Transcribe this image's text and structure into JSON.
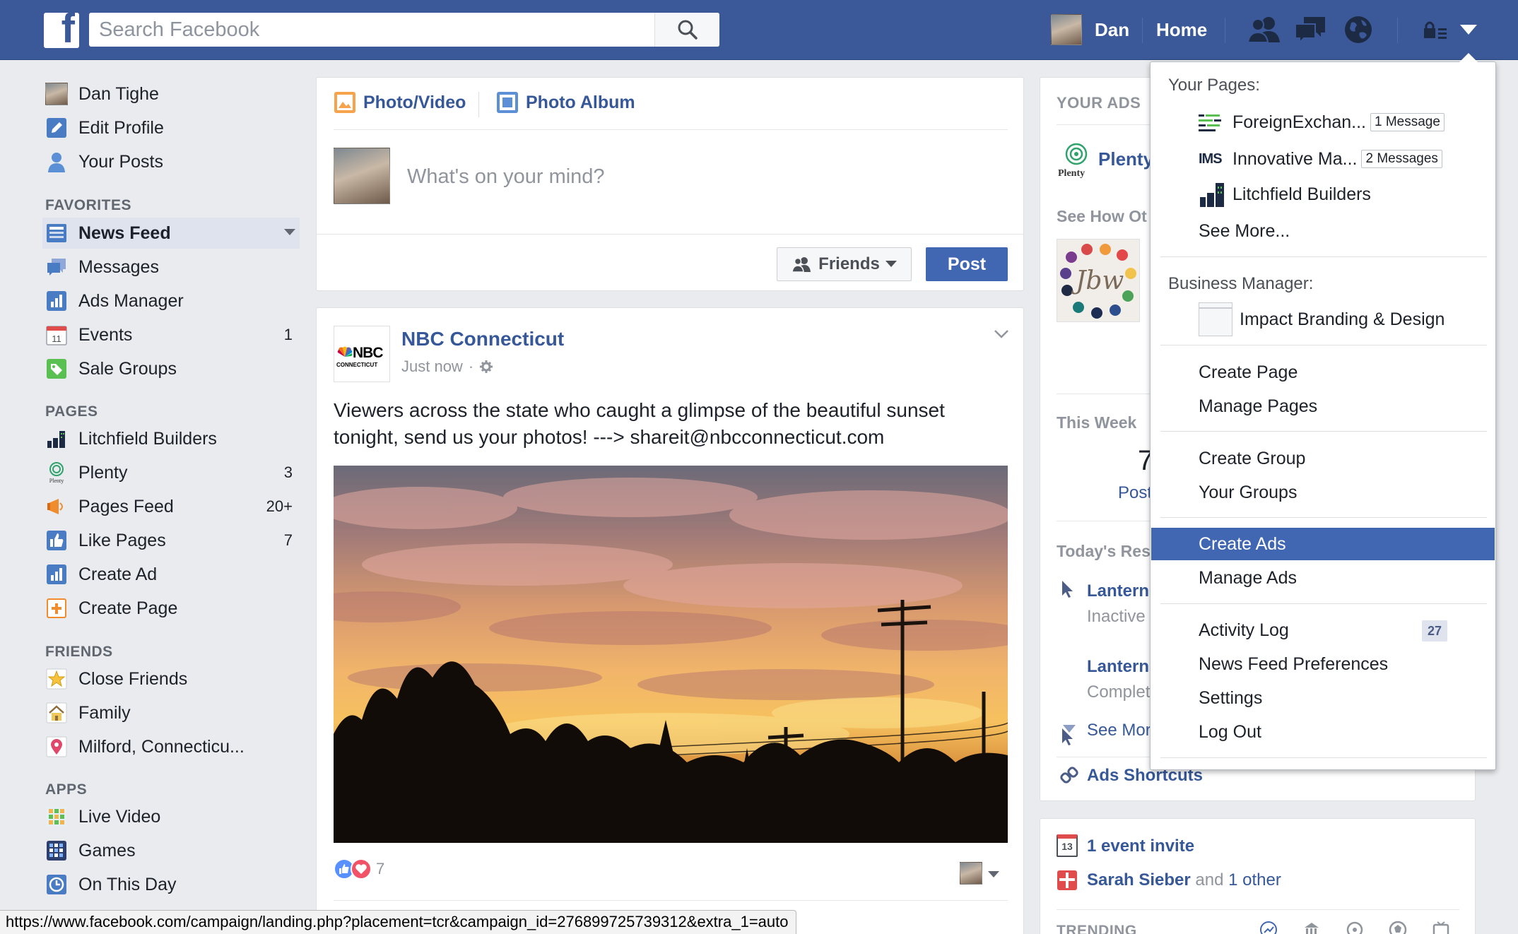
{
  "topbar": {
    "search_placeholder": "Search Facebook",
    "user_name": "Dan",
    "home": "Home"
  },
  "sidebar": {
    "profile": [
      {
        "label": "Dan Tighe"
      },
      {
        "label": "Edit Profile"
      },
      {
        "label": "Your Posts"
      }
    ],
    "favorites_title": "FAVORITES",
    "favorites": [
      {
        "label": "News Feed",
        "count": ""
      },
      {
        "label": "Messages",
        "count": ""
      },
      {
        "label": "Ads Manager",
        "count": ""
      },
      {
        "label": "Events",
        "count": "1"
      },
      {
        "label": "Sale Groups",
        "count": ""
      }
    ],
    "pages_title": "PAGES",
    "pages": [
      {
        "label": "Litchfield Builders",
        "count": ""
      },
      {
        "label": "Plenty",
        "count": "3"
      },
      {
        "label": "Pages Feed",
        "count": "20+"
      },
      {
        "label": "Like Pages",
        "count": "7"
      },
      {
        "label": "Create Ad",
        "count": ""
      },
      {
        "label": "Create Page",
        "count": ""
      }
    ],
    "friends_title": "FRIENDS",
    "friends": [
      {
        "label": "Close Friends"
      },
      {
        "label": "Family"
      },
      {
        "label": "Milford, Connecticu..."
      }
    ],
    "apps_title": "APPS",
    "apps": [
      {
        "label": "Live Video"
      },
      {
        "label": "Games"
      },
      {
        "label": "On This Day"
      }
    ]
  },
  "composer": {
    "photo_video": "Photo/Video",
    "photo_album": "Photo Album",
    "placeholder": "What's on your mind?",
    "audience": "Friends",
    "post": "Post"
  },
  "post": {
    "page_name": "NBC Connecticut",
    "logo_text": "NBC",
    "logo_sub": "CONNECTICUT",
    "time": "Just now",
    "text_line1": "Viewers across the state who caught a glimpse of the beautiful sunset",
    "text_line2": "tonight, send us your photos! ---> shareit@nbcconnecticut.com",
    "reactions_count": "7"
  },
  "right": {
    "your_ads": "YOUR ADS",
    "plenty": "Plenty",
    "plenty_logo": "Plenty",
    "see_how": "See How Ot",
    "jbw": "Jbw",
    "this_week": "This Week",
    "big_num": "7",
    "posts": "Post",
    "todays_res": "Today's Res",
    "lantern1": "Lantern",
    "inactive": "Inactive",
    "lantern2": "Lantern",
    "complete": "Complet",
    "see_more": "See Mor",
    "ads_shortcuts": "Ads Shortcuts",
    "event_num": "13",
    "event_invite": "1 event invite",
    "sarah": "Sarah Sieber",
    "and": "and",
    "one_other": "1 other",
    "trending": "TRENDING"
  },
  "dropdown": {
    "your_pages": "Your Pages:",
    "pages": [
      {
        "label": "ForeignExchan...",
        "badge": "1 Message",
        "icon": "IMS"
      },
      {
        "label": "Innovative Ma...",
        "badge": "2 Messages",
        "icon": "IMS"
      },
      {
        "label": "Litchfield Builders",
        "badge": ""
      }
    ],
    "see_more": "See More...",
    "business_manager": "Business Manager:",
    "business": "Impact Branding & Design",
    "create_page": "Create Page",
    "manage_pages": "Manage Pages",
    "create_group": "Create Group",
    "your_groups": "Your Groups",
    "create_ads": "Create Ads",
    "manage_ads": "Manage Ads",
    "activity_log": "Activity Log",
    "activity_count": "27",
    "news_feed_prefs": "News Feed Preferences",
    "settings": "Settings",
    "log_out": "Log Out"
  },
  "statusbar": {
    "url": "https://www.facebook.com/campaign/landing.php?placement=tcr&campaign_id=276899725739312&extra_1=auto"
  }
}
